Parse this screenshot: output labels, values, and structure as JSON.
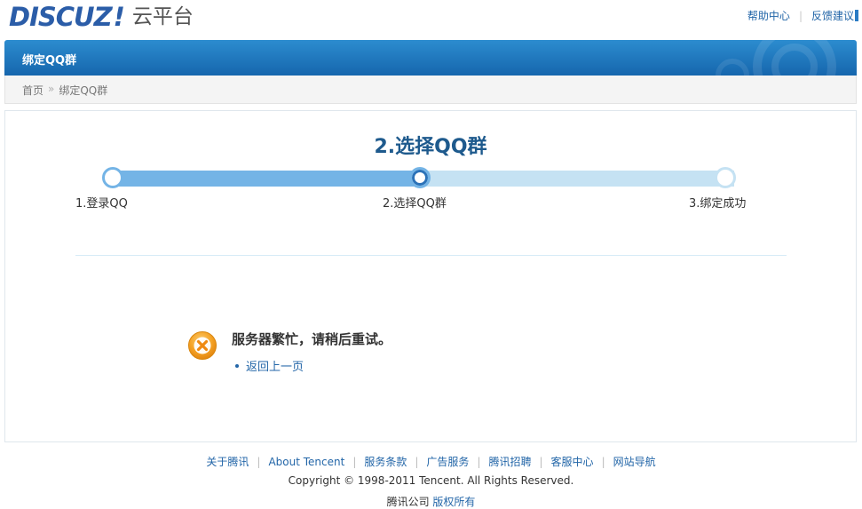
{
  "header": {
    "logo_word": "DISCUZ",
    "logo_bang": "!",
    "logo_sub": "云平台",
    "help_link": "帮助中心",
    "feedback_link": "反馈建议"
  },
  "titlebar": {
    "title": "绑定QQ群"
  },
  "breadcrumb": {
    "home": "首页",
    "arrow": "»",
    "current": "绑定QQ群"
  },
  "wizard": {
    "current_step_title": "2.选择QQ群",
    "progress_fraction": 0.5,
    "steps": [
      {
        "label": "1.登录QQ"
      },
      {
        "label": "2.选择QQ群"
      },
      {
        "label": "3.绑定成功"
      }
    ]
  },
  "message": {
    "icon": "error-icon",
    "text": "服务器繁忙，请稍后重试。",
    "back_link": "返回上一页"
  },
  "footer": {
    "links": [
      "关于腾讯",
      "About Tencent",
      "服务条款",
      "广告服务",
      "腾讯招聘",
      "客服中心",
      "网站导航"
    ],
    "copyright": "Copyright © 1998-2011 Tencent. All Rights Reserved.",
    "company": "腾讯公司",
    "rights": "版权所有"
  },
  "colors": {
    "brand_blue": "#2b5da8",
    "titlebar": "#1f78c1",
    "progress_done": "#74b4e6",
    "progress_todo": "#c5e2f3",
    "error_orange": "#f39a1e"
  }
}
